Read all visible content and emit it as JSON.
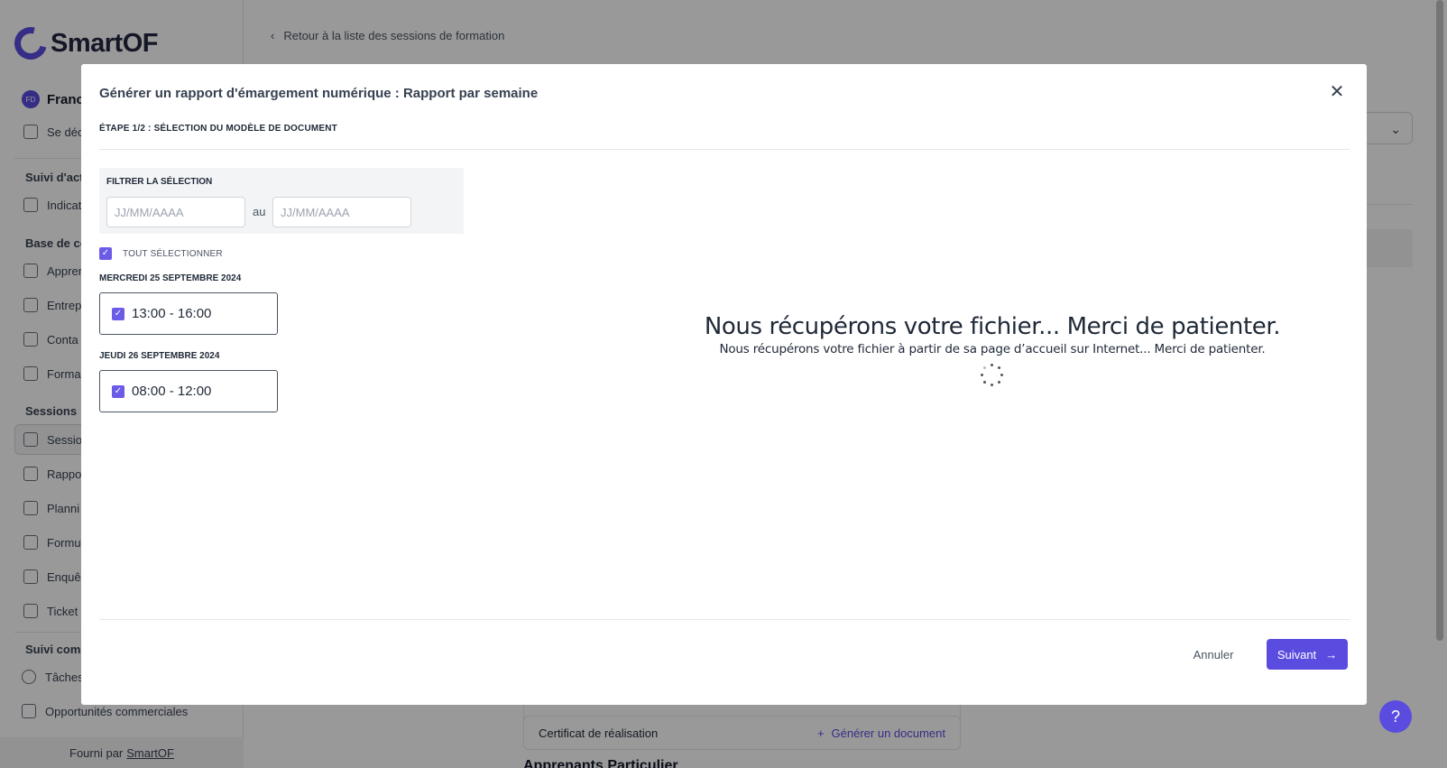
{
  "app": {
    "brand": "SmartOF",
    "user_initials": "FD",
    "user_name": "Franc",
    "logout_label": "Se déc",
    "back_link": "Retour à la liste des sessions de formation",
    "sections": {
      "activity": "Suivi d'acti",
      "base": "Base de co",
      "sessions": "Sessions",
      "commercial": "Suivi comm"
    },
    "nav": {
      "indicators": "Indicat",
      "learners": "Appren",
      "companies": "Entrep",
      "contacts": "Conta",
      "trainings": "Forma",
      "sessions": "Sessio",
      "reports": "Rappo",
      "planning": "Planni",
      "forms": "Formu",
      "surveys": "Enquê",
      "tickets": "Ticket",
      "tasks": "Tâches",
      "opportunities": "Opportunités commerciales"
    },
    "footer_prefix": "Fourni par",
    "footer_link": "SmartOF",
    "bg_card_label": "Certificat de réalisation",
    "bg_card_action": "Générer un document",
    "bg_heading": "Apprenants Particulier",
    "help_label": "?"
  },
  "modal": {
    "title": "Générer un rapport d'émargement numérique : Rapport par semaine",
    "step": "ÉTAPE 1/2 : SÉLECTION DU MODÈLE DE DOCUMENT",
    "filter_label": "FILTRER LA SÉLECTION",
    "date_from_placeholder": "JJ/MM/AAAA",
    "date_to_placeholder": "JJ/MM/AAAA",
    "date_separator": "au",
    "select_all": "TOUT SÉLECTIONNER",
    "days": [
      {
        "label": "MERCREDI 25 SEPTEMBRE 2024",
        "slot": "13:00 - 16:00"
      },
      {
        "label": "JEUDI 26 SEPTEMBRE 2024",
        "slot": "08:00 - 12:00"
      }
    ],
    "loading_title": "Nous récupérons votre fichier... Merci de patienter.",
    "loading_subtitle": "Nous récupérons votre fichier à partir de sa page d’accueil sur Internet... Merci de patienter.",
    "cancel": "Annuler",
    "next": "Suivant"
  },
  "colors": {
    "accent": "#5b4ce0",
    "checkbox": "#6b5ce7",
    "overlay": "rgba(0,0,0,0.4)"
  }
}
